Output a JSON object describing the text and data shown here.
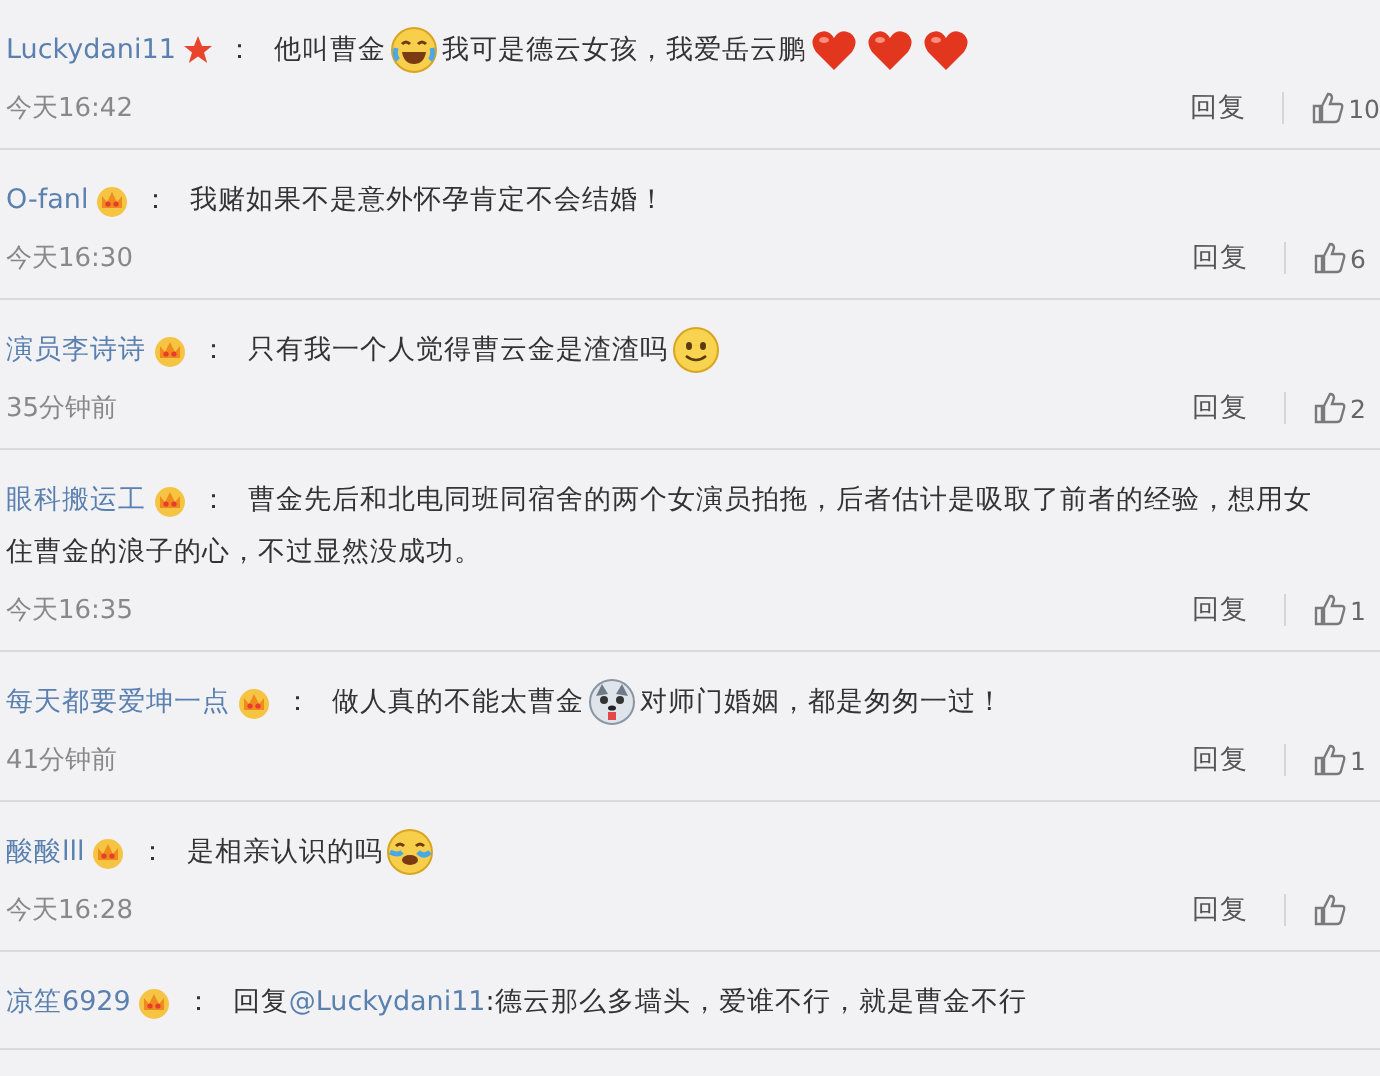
{
  "comments": [
    {
      "user": "Luckydani11",
      "badge": {
        "kind": "star"
      },
      "separator": "：",
      "body": [
        [
          {
            "kind": "text",
            "text": "他叫曹金"
          },
          {
            "kind": "laugh"
          },
          {
            "kind": "text",
            "text": "我可是德云女孩，我爱岳云鹏"
          },
          {
            "kind": "heart"
          },
          {
            "kind": "heart"
          },
          {
            "kind": "heart"
          }
        ]
      ],
      "time": "今天16:42",
      "reply": "回复",
      "likes": "10"
    },
    {
      "user": "O-fanl",
      "badge": {
        "kind": "crown"
      },
      "separator": "：",
      "body": [
        [
          {
            "kind": "text",
            "text": "我赌如果不是意外怀孕肯定不会结婚！"
          }
        ]
      ],
      "time": "今天16:30",
      "reply": "回复",
      "likes": "6"
    },
    {
      "user": "演员李诗诗",
      "badge": {
        "kind": "crown"
      },
      "separator": "：",
      "body": [
        [
          {
            "kind": "text",
            "text": "只有我一个人觉得曹云金是渣渣吗"
          },
          {
            "kind": "smile"
          }
        ]
      ],
      "time": "35分钟前",
      "reply": "回复",
      "likes": "2"
    },
    {
      "user": "眼科搬运工",
      "badge": {
        "kind": "crown"
      },
      "separator": "：",
      "body": [
        [
          {
            "kind": "text",
            "text": "曹金先后和北电同班同宿舍的两个女演员拍拖，后者估计是吸取了前者的经验，想用女"
          }
        ],
        [
          {
            "kind": "text",
            "text": "住曹金的浪子的心，不过显然没成功。"
          }
        ]
      ],
      "time": "今天16:35",
      "reply": "回复",
      "likes": "1"
    },
    {
      "user": "每天都要爱坤一点",
      "badge": {
        "kind": "crown"
      },
      "separator": "：",
      "body": [
        [
          {
            "kind": "text",
            "text": "做人真的不能太曹金"
          },
          {
            "kind": "dog"
          },
          {
            "kind": "text",
            "text": "对师门婚姻，都是匆匆一过！"
          }
        ]
      ],
      "time": "41分钟前",
      "reply": "回复",
      "likes": "1"
    },
    {
      "user": "酸酸lll",
      "badge": {
        "kind": "crown"
      },
      "separator": "：",
      "body": [
        [
          {
            "kind": "text",
            "text": "是相亲认识的吗"
          },
          {
            "kind": "tears"
          }
        ]
      ],
      "time": "今天16:28",
      "reply": "回复"
    },
    {
      "user": "凉笙6929",
      "badge": {
        "kind": "crown"
      },
      "separator": "：",
      "body": [
        [
          {
            "kind": "text",
            "text": "回复"
          },
          {
            "kind": "mention",
            "text": "@Luckydani11"
          },
          {
            "kind": "text",
            "text": ":德云那么多墙头，爱谁不行，就是曹金不行"
          }
        ]
      ]
    }
  ]
}
